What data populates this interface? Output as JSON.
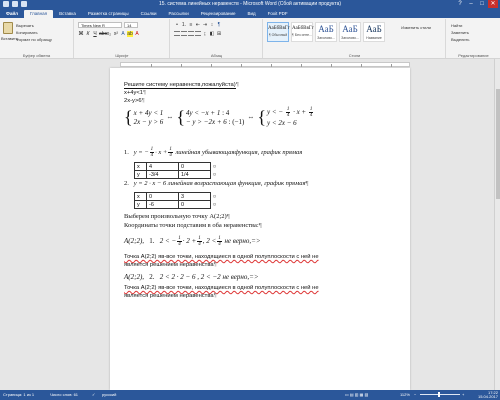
{
  "window": {
    "title": "15. система линейных неравенств - Microsoft Word (Сбой активации продукта)"
  },
  "ribbon_tabs": [
    "Файл",
    "Главная",
    "Вставка",
    "Разметка страницы",
    "Ссылки",
    "Рассылки",
    "Рецензирование",
    "Вид",
    "Foxit PDF"
  ],
  "ribbon": {
    "clipboard": {
      "paste": "Вставить",
      "cut": "Вырезать",
      "copy": "Копировать",
      "format_painter": "Формат по образцу",
      "group_label": "Буфер обмена"
    },
    "font": {
      "font_name": "Times New R",
      "font_size": "14",
      "group_label": "Шрифт"
    },
    "paragraph": {
      "group_label": "Абзац"
    },
    "styles": {
      "tiles": [
        {
          "sample": "АаБбВвГг",
          "name": "¶ Обычный"
        },
        {
          "sample": "АаБбВвГг",
          "name": "¶ Без инте..."
        },
        {
          "sample": "АаБ",
          "name": "Заголово..."
        },
        {
          "sample": "АаБ",
          "name": "Заголово..."
        },
        {
          "sample": "АаБ",
          "name": "Название"
        }
      ],
      "change_styles": "Изменить стили",
      "group_label": "Стили"
    },
    "editing": {
      "find": "Найти",
      "replace": "Заменить",
      "select": "Выделить",
      "group_label": "Редактирование"
    }
  },
  "document": {
    "heading": "Решите систему неравенств,пожалуйста)",
    "line1": "x+4y<1",
    "line2": "2x-y>6",
    "system1": {
      "a": "x + 4y < 1",
      "b": "2x − y > 6"
    },
    "system2": {
      "a": "4y < −x + 1",
      "a_op": ": 4",
      "b": "− y > −2x + 6",
      "b_op": ": (−1)"
    },
    "system3": {
      "a_lhs": "y < −",
      "a_frac_num": "1",
      "a_frac_den": "4",
      "a_mid": "· x +",
      "a_c_num": "1",
      "a_c_den": "4",
      "b": "y < 2x − 6"
    },
    "item1": {
      "num": "1.",
      "eq": "y = −",
      "f_num": "1",
      "f_den": "4",
      "mid": "· x +",
      "c_num": "1",
      "c_den": "4",
      "desc": "линейная убывающаяфункция, график прямая"
    },
    "table1": {
      "row1": [
        "x",
        "4",
        "0"
      ],
      "row2": [
        "y",
        "-3/4",
        "1/4"
      ]
    },
    "item2": {
      "num": "2.",
      "eq": "y = 2 · x − 6",
      "desc": "линейная возрастающая функция, график прямая"
    },
    "table2": {
      "row1": [
        "x",
        "0",
        "3"
      ],
      "row2": [
        "y",
        "-6",
        "0"
      ]
    },
    "choose_point": "Выберем произвольную точку A(2;2)",
    "substitute": "Координаты точки подставим в оба неравенства:",
    "check1": {
      "point": "A(2;2),",
      "num": "1.",
      "expr": "2 < −",
      "f_num": "1",
      "f_den": "4",
      "mid": "· 2 +",
      "c_num": "1",
      "c_den": "4",
      "tail_a": ",   2 <",
      "t_num": "1",
      "t_den": "4",
      "tail_b": "не верно,=>"
    },
    "conclusion1a": "Точка A(2;2) яв-все точки, находящиеся в одной полуплоскости с ней не",
    "conclusion1b": "является решением неравенства",
    "check2": {
      "point": "A(2;2),",
      "num": "2.",
      "expr": "2 < 2 · 2 − 6 ,   2 < −2",
      "tail": "не верно,=>"
    },
    "conclusion2a": "Точка A(2;2) яв-все точки, находящиеся в одной полуплоскости с ней не",
    "conclusion2b": "является решением неравенства"
  },
  "status": {
    "page": "Страница: 1 из 1",
    "words": "Число слов: 61",
    "language": "русский",
    "zoom": "112%",
    "zoom_percent": 112
  },
  "taskbar": {
    "time": "17:22",
    "date": "15.04.2017"
  },
  "colors": {
    "accent": "#2b579a",
    "close": "#c9302c",
    "spellcheck": "#dd3333"
  }
}
